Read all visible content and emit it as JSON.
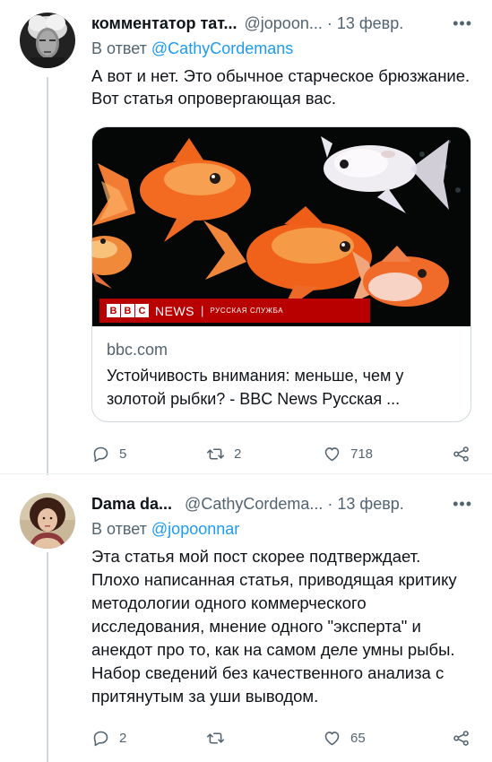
{
  "tweet1": {
    "name": "комментатор тат...",
    "handle": "@jopoon...",
    "separator": "·",
    "date": "13 февр.",
    "more": "•••",
    "reply_prefix": "В ответ",
    "reply_mention": "@CathyCordemans",
    "text": "А вот и нет. Это обычное старческое брюзжание. Вот статья опровергающая вас.",
    "card": {
      "banner_brand": [
        "B",
        "B",
        "C"
      ],
      "banner_news": "NEWS",
      "banner_sep": "|",
      "banner_service": "РУССКАЯ СЛУЖБА",
      "domain": "bbc.com",
      "title": "Устойчивость внимания: меньше, чем у золотой рыбки? - BBC News Русская ..."
    },
    "actions": {
      "replies": "5",
      "retweets": "2",
      "likes": "718"
    }
  },
  "tweet2": {
    "name": "Dama da...",
    "handle": "@CathyCordema...",
    "separator": "·",
    "date": "13 февр.",
    "more": "•••",
    "reply_prefix": "В ответ",
    "reply_mention": "@jopoonnar",
    "text": "Эта статья мой пост скорее подтверждает. Плохо написанная статья, приводящая критику методологии одного коммерческого исследования, мнение одного \"эксперта\" и анекдот про то, как на самом деле умны рыбы. Набор сведений без качественного анализа с притянутым за уши выводом.",
    "actions": {
      "replies": "2",
      "retweets": "",
      "likes": "65"
    }
  },
  "colors": {
    "accent": "#1d9bf0",
    "secondary_text": "#536471",
    "border": "#cfd9de",
    "bbc_red": "#b80000"
  },
  "icons": [
    "reply-icon",
    "retweet-icon",
    "like-icon",
    "share-icon"
  ]
}
